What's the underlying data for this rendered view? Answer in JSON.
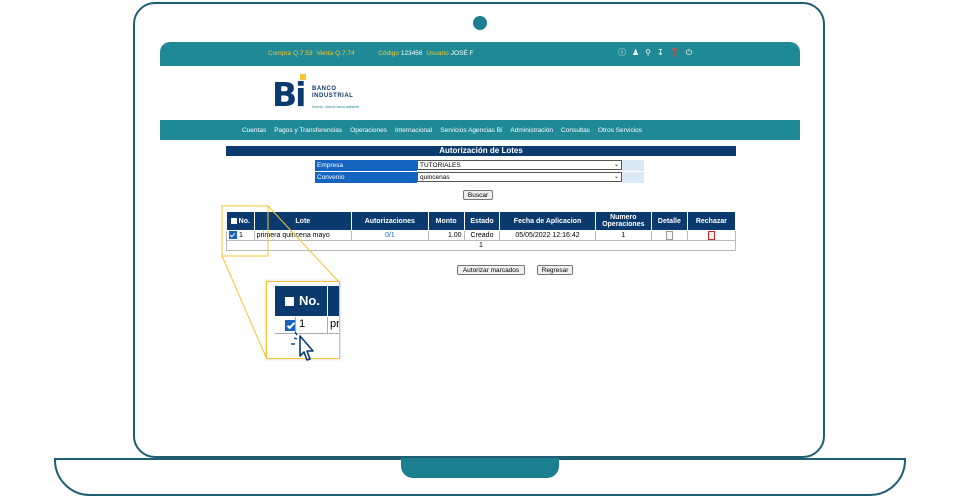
{
  "topbar": {
    "compra_label": "Compra",
    "compra_value": "Q.7.53",
    "venta_label": "Venta",
    "venta_value": "Q.7.74",
    "codigo_label": "Código",
    "codigo_value": "123456",
    "usuario_label": "Usuario",
    "usuario_value": "JOSÉ F",
    "icons": [
      "info-icon",
      "user-icon",
      "location-icon",
      "download-icon",
      "help-icon",
      "power-icon"
    ]
  },
  "logo": {
    "mark": "Bi",
    "line1": "BANCO",
    "line2": "INDUSTRIAL",
    "tagline": "Somos. Vamos hacia adelante"
  },
  "nav": {
    "items": [
      "Cuentas",
      "Pagos y Transferencias",
      "Operaciones",
      "Internacional",
      "Servicios Agencias Bi",
      "Administración",
      "Consultas",
      "Otros Servicios"
    ]
  },
  "page": {
    "title": "Autorización de Lotes"
  },
  "form": {
    "empresa_label": "Empresa",
    "empresa_value": "TUTORIALES",
    "convenio_label": "Convenio",
    "convenio_value": "quincenas",
    "buscar_label": "Buscar"
  },
  "table": {
    "headers": [
      "No.",
      "Lote",
      "Autorizaciones",
      "Monto",
      "Estado",
      "Fecha de Aplicacion",
      "Numero Operaciones",
      "Detalle",
      "Rechazar"
    ],
    "rows": [
      {
        "no": "1",
        "lote": "primera quincena mayo",
        "autorizaciones": "0/1",
        "monto": "1.00",
        "estado": "Creado",
        "fecha": "05/05/2022 12:16:42",
        "operaciones": "1"
      }
    ],
    "page_number": "1"
  },
  "actions": {
    "autorizar_label": "Autorizar marcados",
    "regresar_label": "Regresar"
  },
  "zoom": {
    "header_no": "No.",
    "row_no": "1",
    "row_partial": "pr"
  },
  "colors": {
    "teal": "#1f8a96",
    "navy": "#0b3b6e",
    "blue": "#1565c0",
    "yellow": "#f4c431"
  }
}
